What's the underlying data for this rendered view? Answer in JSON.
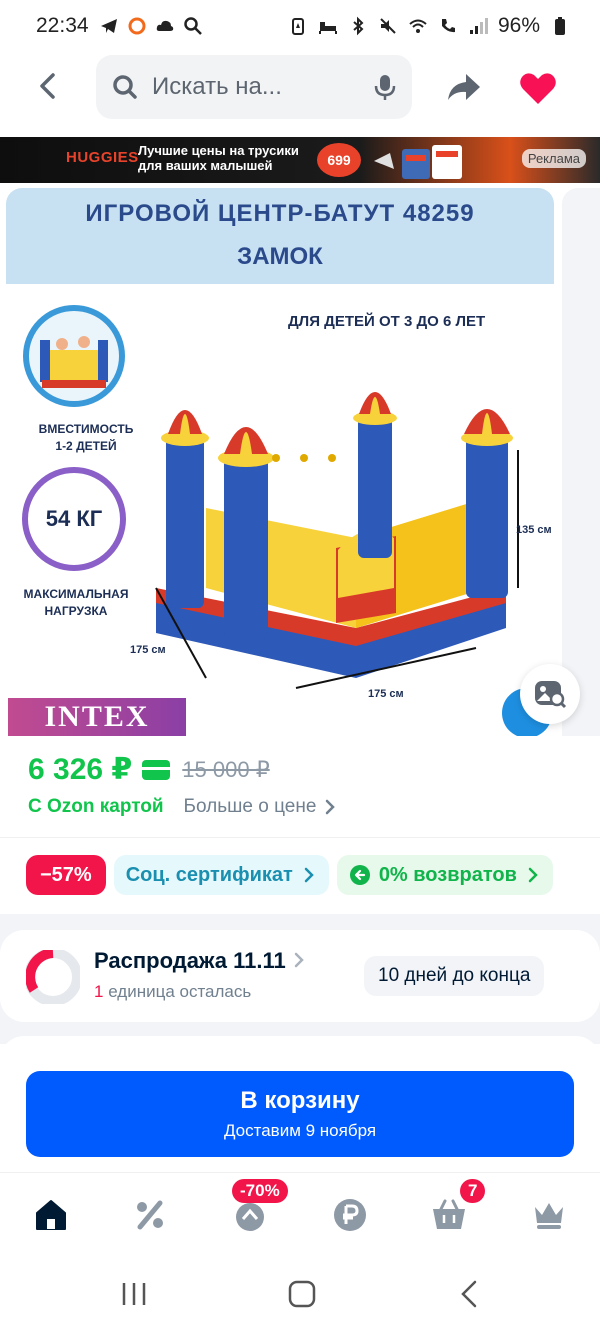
{
  "status_bar": {
    "time": "22:34",
    "battery": "96%",
    "icons": [
      "telegram-icon",
      "ring-icon",
      "cloud-icon",
      "search-icon",
      "battery-saver-icon",
      "bed-icon",
      "bluetooth-icon",
      "mute-icon",
      "wifi-icon",
      "call-icon",
      "signal-icon",
      "battery-icon"
    ]
  },
  "header": {
    "search_placeholder": "Искать на...",
    "icons": [
      "back-icon",
      "search-icon",
      "microphone-icon",
      "share-icon",
      "heart-icon"
    ]
  },
  "ad_banner": {
    "brand": "HUGGIES",
    "slogan_line1": "Лучшие цены на трусики",
    "slogan_line2": "для ваших малышей",
    "price": "699",
    "ad_label": "Реклама"
  },
  "gallery": {
    "title_line1": "ИГРОВОЙ ЦЕНТР-БАТУТ 48259",
    "title_line2": "ЗАМОК",
    "age_text": "ДЛЯ ДЕТЕЙ ОТ 3 ДО 6 ЛЕТ",
    "capacity_line1": "ВМЕСТИМОСТЬ",
    "capacity_line2": "1-2 ДЕТЕЙ",
    "max_weight": "54 КГ",
    "load_line1": "МАКСИМАЛЬНАЯ",
    "load_line2": "НАГРУЗКА",
    "dim_height": "135 см",
    "dim_depth": "175 см",
    "dim_width": "175 см",
    "brand_logo": "INTEX"
  },
  "price": {
    "current": "6 326 ₽",
    "old": "15 000 ₽",
    "ozon_card_label": "С Ozon картой",
    "more_label": "Больше о цене"
  },
  "chips": {
    "discount": "−57%",
    "certificate": "Соц. сертификат",
    "returns": "0% возвратов"
  },
  "sale": {
    "title": "Распродажа 11.11",
    "units_number": "1",
    "units_text": "единица осталась",
    "days_left": "10 дней до конца"
  },
  "cta": {
    "label": "В корзину",
    "delivery": "Доставим 9 ноября"
  },
  "bottom_nav": {
    "promo_badge": "-70%",
    "cart_count": "7",
    "items": [
      "home-icon",
      "percent-icon",
      "fresh-icon",
      "ruble-icon",
      "cart-icon",
      "crown-icon"
    ]
  },
  "colors": {
    "accent": "#005bff",
    "price_green": "#10c44c",
    "discount_red": "#f1154a",
    "heart": "#f91155"
  }
}
